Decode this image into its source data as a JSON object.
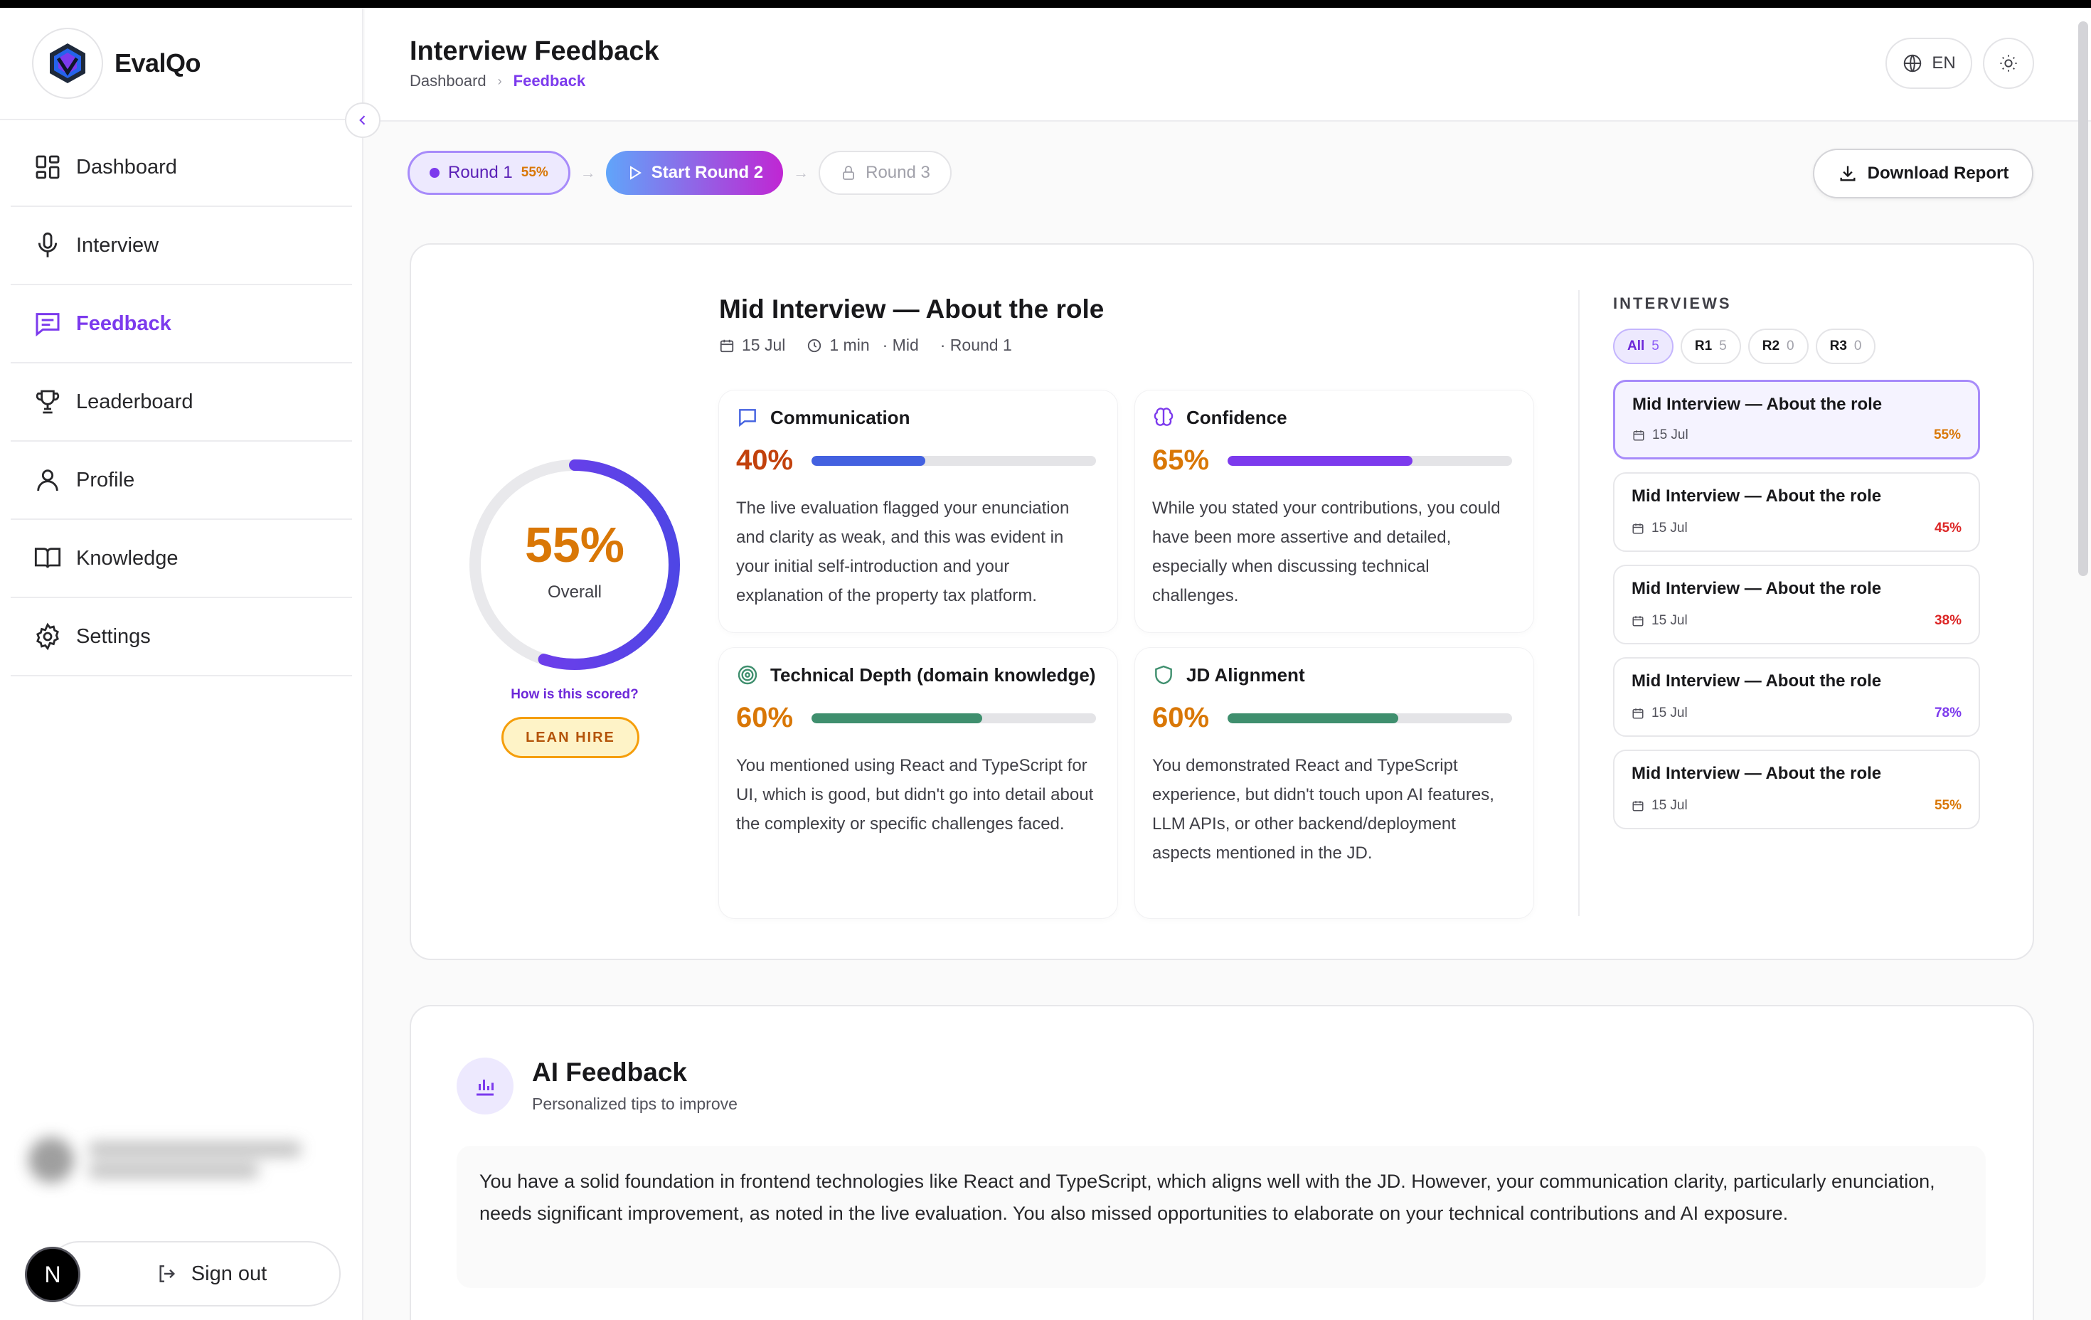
{
  "app": {
    "name": "EvalQo"
  },
  "nav": {
    "items": [
      {
        "label": "Dashboard",
        "icon": "dashboard-icon"
      },
      {
        "label": "Interview",
        "icon": "microphone-icon"
      },
      {
        "label": "Feedback",
        "icon": "feedback-icon",
        "active": true
      },
      {
        "label": "Leaderboard",
        "icon": "trophy-icon"
      },
      {
        "label": "Profile",
        "icon": "user-icon"
      },
      {
        "label": "Knowledge",
        "icon": "book-icon"
      },
      {
        "label": "Settings",
        "icon": "gear-icon"
      }
    ]
  },
  "sidebar_footer": {
    "avatar_letter": "N",
    "signout_label": "Sign out"
  },
  "header": {
    "title": "Interview Feedback",
    "breadcrumb": [
      "Dashboard",
      "Feedback"
    ],
    "language": "EN"
  },
  "rounds": {
    "round1": {
      "label": "Round 1",
      "score": "55%"
    },
    "round2": {
      "label": "Start Round 2"
    },
    "round3": {
      "label": "Round 3"
    },
    "download_label": "Download Report"
  },
  "summary": {
    "overall_pct": "55%",
    "overall_value": 0.55,
    "overall_label": "Overall",
    "how_scored": "How is this scored?",
    "verdict": "LEAN HIRE",
    "title": "Mid Interview — About the role",
    "date": "15 Jul",
    "duration": "1 min",
    "level": "· Mid",
    "round": "· Round 1"
  },
  "metrics": [
    {
      "name": "Communication",
      "icon": "chat-icon",
      "pct": "40%",
      "value": 0.4,
      "pct_color": "#c2410c",
      "bar_color": "#4361e0",
      "text": "The live evaluation flagged your enunciation and clarity as weak, and this was evident in your initial self-introduction and your explanation of the property tax platform."
    },
    {
      "name": "Confidence",
      "icon": "brain-icon",
      "pct": "65%",
      "value": 0.65,
      "pct_color": "#d97706",
      "bar_color": "#7c3aed",
      "text": "While you stated your contributions, you could have been more assertive and detailed, especially when discussing technical challenges."
    },
    {
      "name": "Technical Depth (domain knowledge)",
      "icon": "target-icon",
      "pct": "60%",
      "value": 0.6,
      "pct_color": "#d97706",
      "bar_color": "#3f8f6e",
      "text": "You mentioned using React and TypeScript for UI, which is good, but didn't go into detail about the complexity or specific challenges faced."
    },
    {
      "name": "JD Alignment",
      "icon": "shield-icon",
      "pct": "60%",
      "value": 0.6,
      "pct_color": "#d97706",
      "bar_color": "#3f8f6e",
      "text": "You demonstrated React and TypeScript experience, but didn't touch upon AI features, LLM APIs, or other backend/deployment aspects mentioned in the JD."
    }
  ],
  "interviews": {
    "label": "INTERVIEWS",
    "filters": [
      {
        "label": "All",
        "count": "5",
        "active": true
      },
      {
        "label": "R1",
        "count": "5"
      },
      {
        "label": "R2",
        "count": "0"
      },
      {
        "label": "R3",
        "count": "0"
      }
    ],
    "items": [
      {
        "title": "Mid Interview — About the role",
        "date": "15 Jul",
        "score": "55%",
        "color": "#d97706",
        "active": true
      },
      {
        "title": "Mid Interview — About the role",
        "date": "15 Jul",
        "score": "45%",
        "color": "#dc2626"
      },
      {
        "title": "Mid Interview — About the role",
        "date": "15 Jul",
        "score": "38%",
        "color": "#dc2626"
      },
      {
        "title": "Mid Interview — About the role",
        "date": "15 Jul",
        "score": "78%",
        "color": "#7c3aed"
      },
      {
        "title": "Mid Interview — About the role",
        "date": "15 Jul",
        "score": "55%",
        "color": "#d97706"
      }
    ]
  },
  "ai_feedback": {
    "title": "AI Feedback",
    "subtitle": "Personalized tips to improve",
    "body": "You have a solid foundation in frontend technologies like React and TypeScript, which aligns well with the JD. However, your communication clarity, particularly enunciation, needs significant improvement, as noted in the live evaluation. You also missed opportunities to elaborate on your technical contributions and AI exposure."
  },
  "colors": {
    "accent": "#7c3aed",
    "amber": "#d97706",
    "gauge_track": "#e9e9ec"
  }
}
